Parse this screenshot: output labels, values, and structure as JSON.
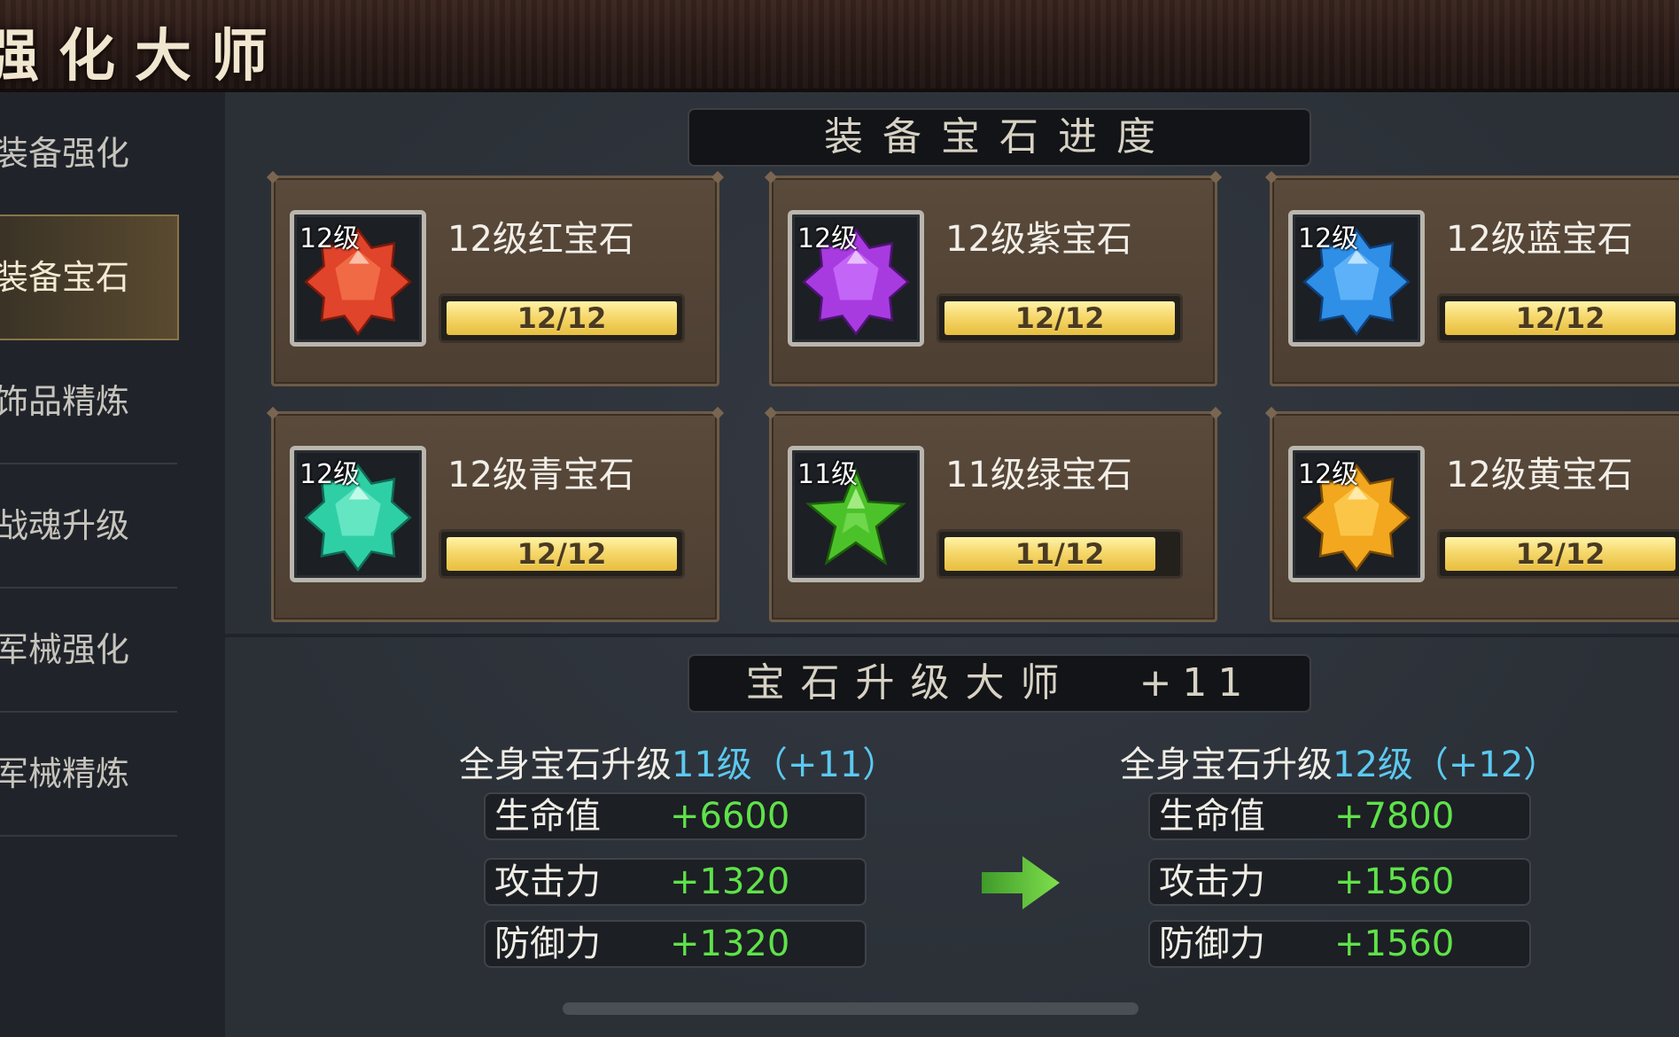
{
  "title": "强化大师",
  "sidebar": {
    "items": [
      {
        "label": "装备强化",
        "active": false
      },
      {
        "label": "装备宝石",
        "active": true
      },
      {
        "label": "饰品精炼",
        "active": false
      },
      {
        "label": "战魂升级",
        "active": false
      },
      {
        "label": "军械强化",
        "active": false
      },
      {
        "label": "军械精炼",
        "active": false
      }
    ]
  },
  "progress_section": {
    "header": "装备宝石进度",
    "gems": [
      {
        "level_badge": "12级",
        "name": "12级红宝石",
        "progress_text": "12/12",
        "progress": 1.0,
        "color": "#e0442a",
        "icon": "red-gem-icon"
      },
      {
        "level_badge": "12级",
        "name": "12级紫宝石",
        "progress_text": "12/12",
        "progress": 1.0,
        "color": "#a83be0",
        "icon": "purple-gem-icon"
      },
      {
        "level_badge": "12级",
        "name": "12级蓝宝石",
        "progress_text": "12/12",
        "progress": 1.0,
        "color": "#2f8ee6",
        "icon": "blue-gem-icon"
      },
      {
        "level_badge": "12级",
        "name": "12级青宝石",
        "progress_text": "12/12",
        "progress": 1.0,
        "color": "#2fcfa6",
        "icon": "cyan-gem-icon"
      },
      {
        "level_badge": "11级",
        "name": "11级绿宝石",
        "progress_text": "11/12",
        "progress": 0.9167,
        "color": "#4cc22a",
        "icon": "green-gem-icon"
      },
      {
        "level_badge": "12级",
        "name": "12级黄宝石",
        "progress_text": "12/12",
        "progress": 1.0,
        "color": "#f2a71e",
        "icon": "yellow-gem-icon"
      }
    ]
  },
  "master_section": {
    "header": "宝石升级大师",
    "header_bonus": "+11",
    "current": {
      "prefix": "全身宝石升级",
      "highlight": "11级（+11）",
      "stats": [
        {
          "label": "生命值",
          "value": "+6600"
        },
        {
          "label": "攻击力",
          "value": "+1320"
        },
        {
          "label": "防御力",
          "value": "+1320"
        }
      ]
    },
    "next": {
      "prefix": "全身宝石升级",
      "highlight": "12级（+12）",
      "stats": [
        {
          "label": "生命值",
          "value": "+7800"
        },
        {
          "label": "攻击力",
          "value": "+1560"
        },
        {
          "label": "防御力",
          "value": "+1560"
        }
      ]
    },
    "arrow_icon": "right-arrow-icon"
  }
}
